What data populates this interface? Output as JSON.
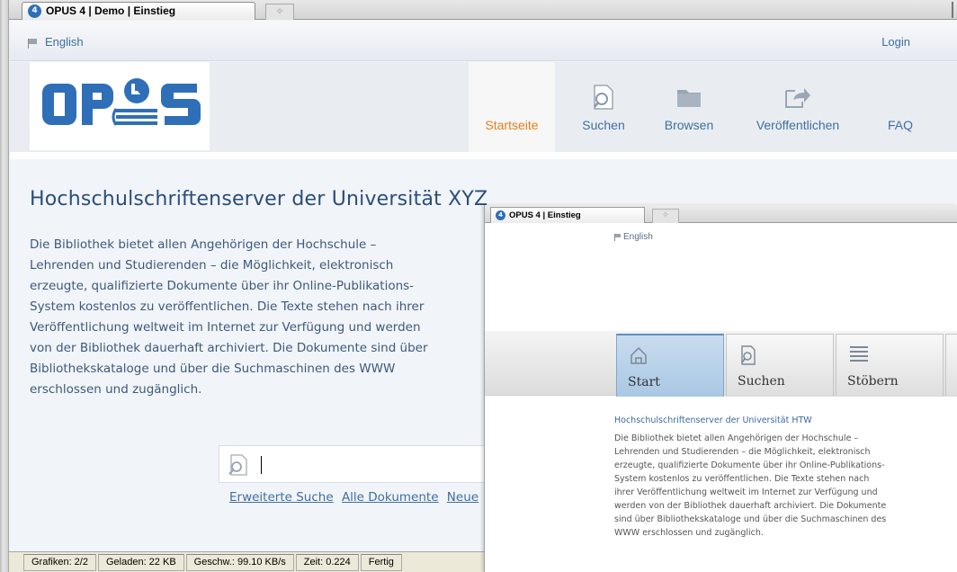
{
  "background_window": {
    "tab_title": "OPUS 4 | Demo | Einstieg",
    "tab_icon": "opus-favicon",
    "new_tab_glyph": "✧",
    "language_link": "English",
    "login_link": "Login",
    "logo_alt": "OPUS",
    "nav": [
      {
        "label": "Startseite",
        "icon": "none"
      },
      {
        "label": "Suchen",
        "icon": "search-document-icon"
      },
      {
        "label": "Browsen",
        "icon": "folder-icon"
      },
      {
        "label": "Veröffentlichen",
        "icon": "share-arrow-icon"
      },
      {
        "label": "FAQ",
        "icon": "none"
      }
    ],
    "heading": "Hochschulschriftenserver der Universität XYZ",
    "intro_lines": [
      "Die Bibliothek bietet allen Angehörigen der Hochschule –",
      "Lehrenden und Studierenden – die Möglichkeit, elektronisch",
      "erzeugte, qualifizierte Dokumente über ihr Online-Publikations-",
      "System kostenlos zu veröffentlichen. Die Texte stehen nach ihrer",
      "Veröffentlichung weltweit im Internet zur Verfügung und werden",
      "von der Bibliothek dauerhaft archiviert. Die Dokumente sind über",
      "Bibliothekskataloge und über die Suchmaschinen des WWW",
      "erschlossen und zugänglich."
    ],
    "search": {
      "value": ""
    },
    "search_links": [
      "Erweiterte Suche",
      "Alle Dokumente",
      "Neue"
    ],
    "status": {
      "images": "Grafiken: 2/2",
      "loaded": "Geladen: 22 KB",
      "speed": "Geschw.: 99.10 KB/s",
      "time": "Zeit: 0.224",
      "state": "Fertig"
    }
  },
  "foreground_window": {
    "tab_title": "OPUS 4 | Einstieg",
    "new_tab_glyph": "✧",
    "language_link": "English",
    "nav": [
      {
        "label": "Start",
        "icon": "home-icon",
        "active": true
      },
      {
        "label": "Suchen",
        "icon": "search-document-icon",
        "active": false
      },
      {
        "label": "Stöbern",
        "icon": "list-icon",
        "active": false
      },
      {
        "label": "",
        "icon": "",
        "active": false
      }
    ],
    "title": "Hochschulschriftenserver der Universität HTW",
    "text_lines": [
      "Die Bibliothek bietet allen Angehörigen der Hochschule –",
      "Lehrenden und Studierenden – die Möglichkeit, elektronisch",
      "erzeugte, qualifizierte Dokumente über ihr Online-Publikations-",
      "System kostenlos zu veröffentlichen. Die Texte stehen nach",
      "ihrer Veröffentlichung weltweit im Internet zur Verfügung und",
      "werden von der Bibliothek dauerhaft archiviert. Die Dokumente",
      "sind über Bibliothekskataloge und über die Suchmaschinen des",
      "WWW erschlossen und zugänglich."
    ]
  },
  "colors": {
    "brand_blue": "#2f6fb7",
    "active_nav": "#e97e1d",
    "link_blue": "#3f6fa0"
  }
}
